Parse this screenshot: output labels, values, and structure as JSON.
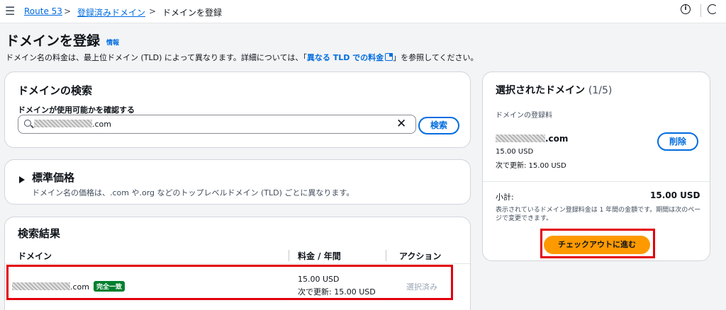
{
  "breadcrumb": {
    "items": [
      "Route 53",
      "登録済みドメイン",
      "ドメインを登録"
    ]
  },
  "header": {
    "title": "ドメインを登録",
    "info_link": "情報",
    "desc_before": "ドメイン名の料金は、最上位ドメイン (TLD) によって異なります。詳細については、「",
    "desc_link": "異なる TLD での料金",
    "desc_after": "」を参照してください。"
  },
  "search_card": {
    "title": "ドメインの検索",
    "label": "ドメインが使用可能かを確認する",
    "input_suffix": ".com",
    "search_button": "検索"
  },
  "pricing_card": {
    "title": "標準価格",
    "desc": "ドメイン名の価格は、.com や.org などのトップレベルドメイン (TLD) ごとに異なります。"
  },
  "results_card": {
    "title": "検索結果",
    "columns": [
      "ドメイン",
      "料金 / 年間",
      "アクション"
    ],
    "row": {
      "domain_suffix": ".com",
      "badge": "完全一致",
      "price": "15.00 USD",
      "renewal": "次で更新: 15.00 USD",
      "action": "選択済み"
    }
  },
  "selected_panel": {
    "title": "選択されたドメイン",
    "count": "(1/5)",
    "fee_label": "ドメインの登録料",
    "domain_suffix": ".com",
    "price": "15.00 USD",
    "renewal": "次で更新: 15.00 USD",
    "remove_button": "削除",
    "subtotal_label": "小計:",
    "subtotal_value": "15.00 USD",
    "note": "表示されているドメイン登録料金は 1 年間の金額です。期間は次のページで変更できます。",
    "checkout_button": "チェックアウトに進む"
  },
  "colors": {
    "link": "#006ce0",
    "accent_orange": "#ff9900",
    "badge_green": "#00802f",
    "highlight_red": "#e3000b"
  }
}
